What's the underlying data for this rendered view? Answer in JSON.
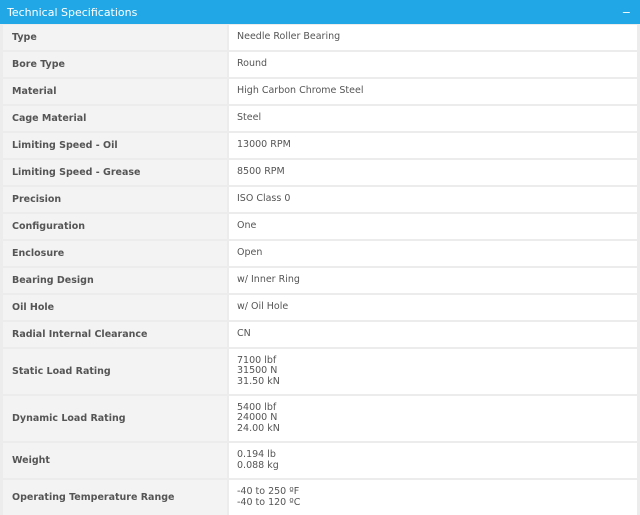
{
  "header": {
    "title": "Technical Specifications",
    "collapse_icon": "minus-icon"
  },
  "specs": [
    {
      "label": "Type",
      "values": [
        "Needle Roller Bearing"
      ]
    },
    {
      "label": "Bore Type",
      "values": [
        "Round"
      ]
    },
    {
      "label": "Material",
      "values": [
        "High Carbon Chrome Steel"
      ]
    },
    {
      "label": "Cage Material",
      "values": [
        "Steel"
      ]
    },
    {
      "label": "Limiting Speed - Oil",
      "values": [
        "13000 RPM"
      ]
    },
    {
      "label": "Limiting Speed - Grease",
      "values": [
        "8500 RPM"
      ]
    },
    {
      "label": "Precision",
      "values": [
        "ISO Class 0"
      ]
    },
    {
      "label": "Configuration",
      "values": [
        "One"
      ]
    },
    {
      "label": "Enclosure",
      "values": [
        "Open"
      ]
    },
    {
      "label": "Bearing Design",
      "values": [
        "w/ Inner Ring"
      ]
    },
    {
      "label": "Oil Hole",
      "values": [
        "w/ Oil Hole"
      ]
    },
    {
      "label": "Radial Internal Clearance",
      "values": [
        "CN"
      ]
    },
    {
      "label": "Static Load Rating",
      "values": [
        "7100 lbf",
        "31500 N",
        "31.50 kN"
      ]
    },
    {
      "label": "Dynamic Load Rating",
      "values": [
        "5400 lbf",
        "24000 N",
        "24.00 kN"
      ]
    },
    {
      "label": "Weight",
      "values": [
        "0.194 lb",
        "0.088 kg"
      ]
    },
    {
      "label": "Operating Temperature Range",
      "values": [
        "-40 to 250 ºF",
        "-40 to 120 ºC"
      ]
    }
  ]
}
